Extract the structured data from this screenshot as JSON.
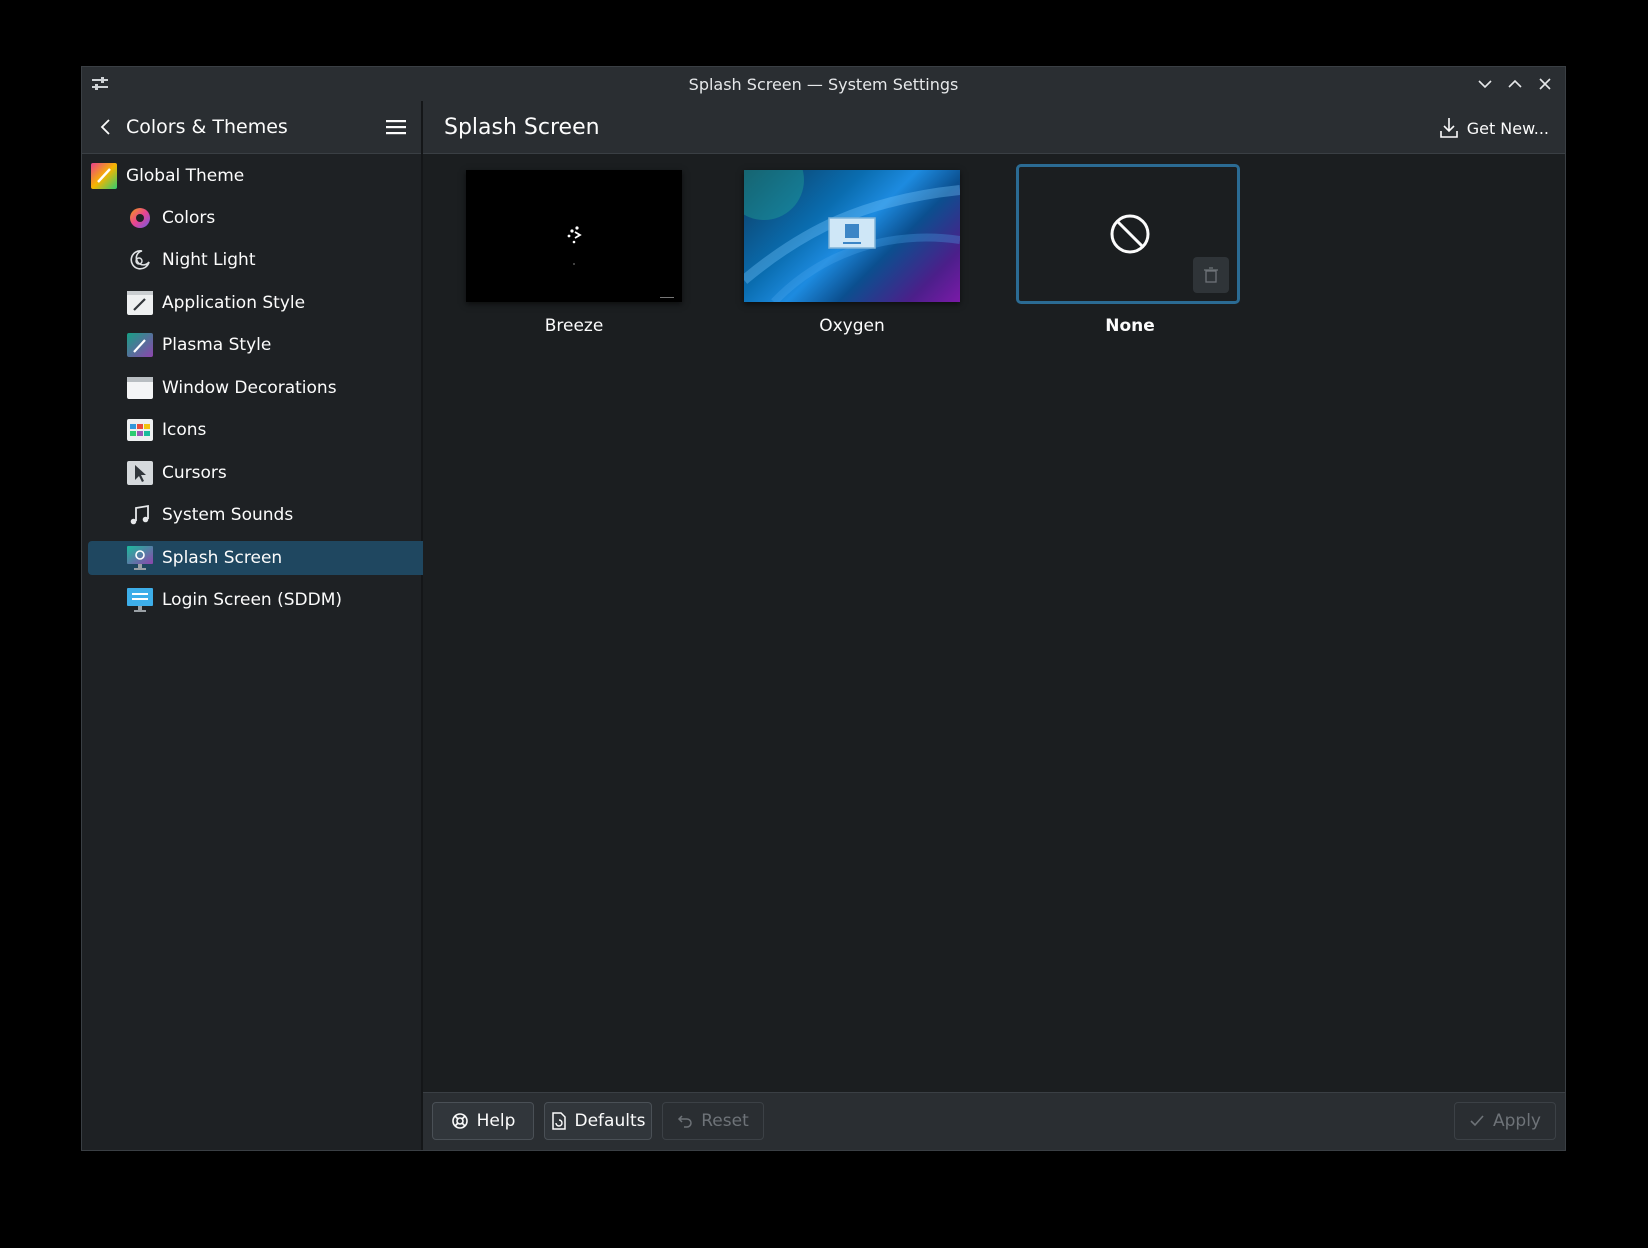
{
  "window": {
    "title": "Splash Screen — System Settings"
  },
  "sidebar": {
    "title": "Colors & Themes",
    "items": [
      {
        "label": "Global Theme",
        "icon": "global-theme-icon"
      },
      {
        "label": "Colors",
        "icon": "colors-icon"
      },
      {
        "label": "Night Light",
        "icon": "night-light-icon"
      },
      {
        "label": "Application Style",
        "icon": "application-style-icon"
      },
      {
        "label": "Plasma Style",
        "icon": "plasma-style-icon"
      },
      {
        "label": "Window Decorations",
        "icon": "window-decorations-icon"
      },
      {
        "label": "Icons",
        "icon": "icons-icon"
      },
      {
        "label": "Cursors",
        "icon": "cursors-icon"
      },
      {
        "label": "System Sounds",
        "icon": "system-sounds-icon"
      },
      {
        "label": "Splash Screen",
        "icon": "splash-screen-icon",
        "selected": true
      },
      {
        "label": "Login Screen (SDDM)",
        "icon": "login-screen-icon"
      }
    ]
  },
  "header": {
    "title": "Splash Screen",
    "get_new_label": "Get New..."
  },
  "themes": [
    {
      "name": "Breeze"
    },
    {
      "name": "Oxygen"
    },
    {
      "name": "None",
      "selected": true
    }
  ],
  "footer": {
    "help_label": "Help",
    "defaults_label": "Defaults",
    "reset_label": "Reset",
    "apply_label": "Apply"
  },
  "colors": {
    "accent": "#2b6b93",
    "selection": "#1f4760",
    "background": "#1b1e20"
  }
}
